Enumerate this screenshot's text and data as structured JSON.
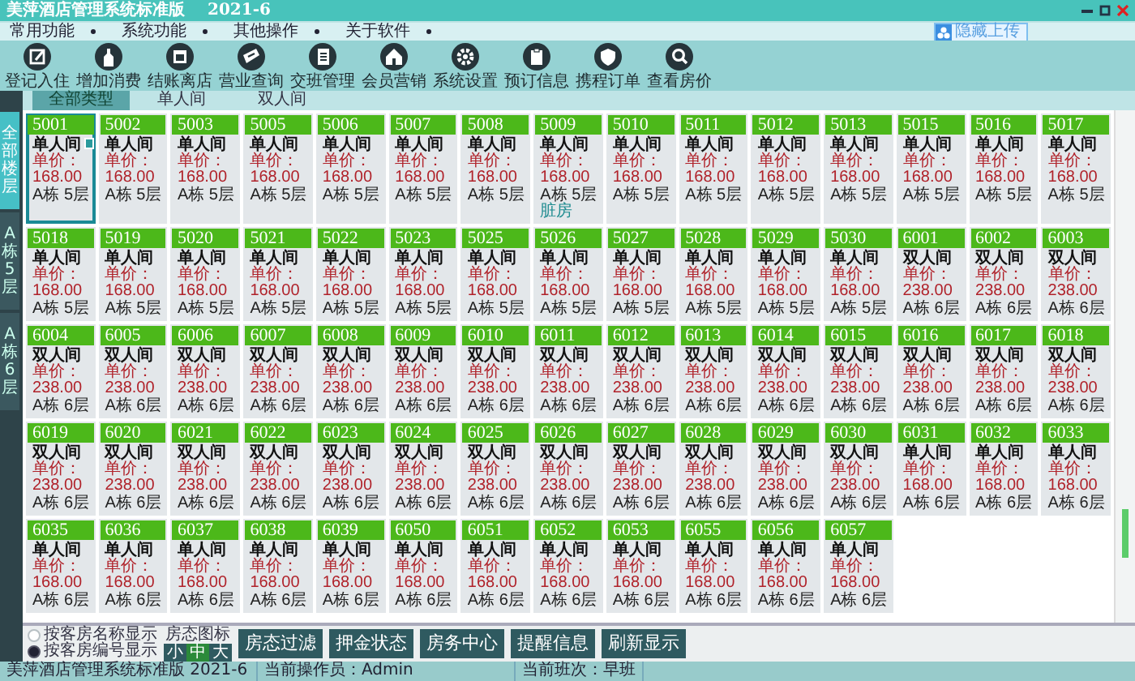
{
  "window": {
    "title": "美萍酒店管理系统标准版",
    "version": "2021-6"
  },
  "menu": [
    "常用功能",
    "系统功能",
    "其他操作",
    "关于软件"
  ],
  "upload_button": "隐藏上传",
  "toolbar": [
    "登记入住",
    "增加消费",
    "结账离店",
    "营业查询",
    "交班管理",
    "会员营销",
    "系统设置",
    "预订信息",
    "携程订单",
    "查看房价"
  ],
  "type_tabs": [
    {
      "label": "全部类型",
      "selected": true
    },
    {
      "label": "单人间",
      "selected": false
    },
    {
      "label": "双人间",
      "selected": false
    }
  ],
  "floor_tabs": [
    {
      "label": "全部楼层",
      "selected": true
    },
    {
      "label": "A栋5层",
      "selected": false
    },
    {
      "label": "A栋6层",
      "selected": false
    }
  ],
  "rooms": [
    {
      "number": "5001",
      "type": "单人间",
      "price": "单价：168.00",
      "location": "A栋 5层",
      "selected": true
    },
    {
      "number": "5002",
      "type": "单人间",
      "price": "单价：168.00",
      "location": "A栋 5层",
      "selected": false
    },
    {
      "number": "5003",
      "type": "单人间",
      "price": "单价：168.00",
      "location": "A栋 5层",
      "selected": false
    },
    {
      "number": "5005",
      "type": "单人间",
      "price": "单价：168.00",
      "location": "A栋 5层",
      "selected": false
    },
    {
      "number": "5006",
      "type": "单人间",
      "price": "单价：168.00",
      "location": "A栋 5层",
      "selected": false
    },
    {
      "number": "5007",
      "type": "单人间",
      "price": "单价：168.00",
      "location": "A栋 5层",
      "selected": false
    },
    {
      "number": "5008",
      "type": "单人间",
      "price": "单价：168.00",
      "location": "A栋 5层",
      "selected": false
    },
    {
      "number": "5009",
      "type": "单人间",
      "price": "单价：168.00",
      "location": "A栋 5层",
      "status": "脏房",
      "selected": false
    },
    {
      "number": "5010",
      "type": "单人间",
      "price": "单价：168.00",
      "location": "A栋 5层",
      "selected": false
    },
    {
      "number": "5011",
      "type": "单人间",
      "price": "单价：168.00",
      "location": "A栋 5层",
      "selected": false
    },
    {
      "number": "5012",
      "type": "单人间",
      "price": "单价：168.00",
      "location": "A栋 5层",
      "selected": false
    },
    {
      "number": "5013",
      "type": "单人间",
      "price": "单价：168.00",
      "location": "A栋 5层",
      "selected": false
    },
    {
      "number": "5015",
      "type": "单人间",
      "price": "单价：168.00",
      "location": "A栋 5层",
      "selected": false
    },
    {
      "number": "5016",
      "type": "单人间",
      "price": "单价：168.00",
      "location": "A栋 5层",
      "selected": false
    },
    {
      "number": "5017",
      "type": "单人间",
      "price": "单价：168.00",
      "location": "A栋 5层",
      "selected": false
    },
    {
      "number": "5018",
      "type": "单人间",
      "price": "单价：168.00",
      "location": "A栋 5层",
      "selected": false
    },
    {
      "number": "5019",
      "type": "单人间",
      "price": "单价：168.00",
      "location": "A栋 5层",
      "selected": false
    },
    {
      "number": "5020",
      "type": "单人间",
      "price": "单价：168.00",
      "location": "A栋 5层",
      "selected": false
    },
    {
      "number": "5021",
      "type": "单人间",
      "price": "单价：168.00",
      "location": "A栋 5层",
      "selected": false
    },
    {
      "number": "5022",
      "type": "单人间",
      "price": "单价：168.00",
      "location": "A栋 5层",
      "selected": false
    },
    {
      "number": "5023",
      "type": "单人间",
      "price": "单价：168.00",
      "location": "A栋 5层",
      "selected": false
    },
    {
      "number": "5025",
      "type": "单人间",
      "price": "单价：168.00",
      "location": "A栋 5层",
      "selected": false
    },
    {
      "number": "5026",
      "type": "单人间",
      "price": "单价：168.00",
      "location": "A栋 5层",
      "selected": false
    },
    {
      "number": "5027",
      "type": "单人间",
      "price": "单价：168.00",
      "location": "A栋 5层",
      "selected": false
    },
    {
      "number": "5028",
      "type": "单人间",
      "price": "单价：168.00",
      "location": "A栋 5层",
      "selected": false
    },
    {
      "number": "5029",
      "type": "单人间",
      "price": "单价：168.00",
      "location": "A栋 5层",
      "selected": false
    },
    {
      "number": "5030",
      "type": "单人间",
      "price": "单价：168.00",
      "location": "A栋 5层",
      "selected": false
    },
    {
      "number": "6001",
      "type": "双人间",
      "price": "单价：238.00",
      "location": "A栋 6层",
      "selected": false
    },
    {
      "number": "6002",
      "type": "双人间",
      "price": "单价：238.00",
      "location": "A栋 6层",
      "selected": false
    },
    {
      "number": "6003",
      "type": "双人间",
      "price": "单价：238.00",
      "location": "A栋 6层",
      "selected": false
    },
    {
      "number": "6004",
      "type": "双人间",
      "price": "单价：238.00",
      "location": "A栋 6层",
      "selected": false
    },
    {
      "number": "6005",
      "type": "双人间",
      "price": "单价：238.00",
      "location": "A栋 6层",
      "selected": false
    },
    {
      "number": "6006",
      "type": "双人间",
      "price": "单价：238.00",
      "location": "A栋 6层",
      "selected": false
    },
    {
      "number": "6007",
      "type": "双人间",
      "price": "单价：238.00",
      "location": "A栋 6层",
      "selected": false
    },
    {
      "number": "6008",
      "type": "双人间",
      "price": "单价：238.00",
      "location": "A栋 6层",
      "selected": false
    },
    {
      "number": "6009",
      "type": "双人间",
      "price": "单价：238.00",
      "location": "A栋 6层",
      "selected": false
    },
    {
      "number": "6010",
      "type": "双人间",
      "price": "单价：238.00",
      "location": "A栋 6层",
      "selected": false
    },
    {
      "number": "6011",
      "type": "双人间",
      "price": "单价：238.00",
      "location": "A栋 6层",
      "selected": false
    },
    {
      "number": "6012",
      "type": "双人间",
      "price": "单价：238.00",
      "location": "A栋 6层",
      "selected": false
    },
    {
      "number": "6013",
      "type": "双人间",
      "price": "单价：238.00",
      "location": "A栋 6层",
      "selected": false
    },
    {
      "number": "6014",
      "type": "双人间",
      "price": "单价：238.00",
      "location": "A栋 6层",
      "selected": false
    },
    {
      "number": "6015",
      "type": "双人间",
      "price": "单价：238.00",
      "location": "A栋 6层",
      "selected": false
    },
    {
      "number": "6016",
      "type": "双人间",
      "price": "单价：238.00",
      "location": "A栋 6层",
      "selected": false
    },
    {
      "number": "6017",
      "type": "双人间",
      "price": "单价：238.00",
      "location": "A栋 6层",
      "selected": false
    },
    {
      "number": "6018",
      "type": "双人间",
      "price": "单价：238.00",
      "location": "A栋 6层",
      "selected": false
    },
    {
      "number": "6019",
      "type": "双人间",
      "price": "单价：238.00",
      "location": "A栋 6层",
      "selected": false
    },
    {
      "number": "6020",
      "type": "双人间",
      "price": "单价：238.00",
      "location": "A栋 6层",
      "selected": false
    },
    {
      "number": "6021",
      "type": "双人间",
      "price": "单价：238.00",
      "location": "A栋 6层",
      "selected": false
    },
    {
      "number": "6022",
      "type": "双人间",
      "price": "单价：238.00",
      "location": "A栋 6层",
      "selected": false
    },
    {
      "number": "6023",
      "type": "双人间",
      "price": "单价：238.00",
      "location": "A栋 6层",
      "selected": false
    },
    {
      "number": "6024",
      "type": "双人间",
      "price": "单价：238.00",
      "location": "A栋 6层",
      "selected": false
    },
    {
      "number": "6025",
      "type": "双人间",
      "price": "单价：238.00",
      "location": "A栋 6层",
      "selected": false
    },
    {
      "number": "6026",
      "type": "双人间",
      "price": "单价：238.00",
      "location": "A栋 6层",
      "selected": false
    },
    {
      "number": "6027",
      "type": "双人间",
      "price": "单价：238.00",
      "location": "A栋 6层",
      "selected": false
    },
    {
      "number": "6028",
      "type": "双人间",
      "price": "单价：238.00",
      "location": "A栋 6层",
      "selected": false
    },
    {
      "number": "6029",
      "type": "双人间",
      "price": "单价：238.00",
      "location": "A栋 6层",
      "selected": false
    },
    {
      "number": "6030",
      "type": "双人间",
      "price": "单价：238.00",
      "location": "A栋 6层",
      "selected": false
    },
    {
      "number": "6031",
      "type": "单人间",
      "price": "单价：168.00",
      "location": "A栋 6层",
      "selected": false
    },
    {
      "number": "6032",
      "type": "单人间",
      "price": "单价：168.00",
      "location": "A栋 6层",
      "selected": false
    },
    {
      "number": "6033",
      "type": "单人间",
      "price": "单价：168.00",
      "location": "A栋 6层",
      "selected": false
    },
    {
      "number": "6035",
      "type": "单人间",
      "price": "单价：168.00",
      "location": "A栋 6层",
      "selected": false
    },
    {
      "number": "6036",
      "type": "单人间",
      "price": "单价：168.00",
      "location": "A栋 6层",
      "selected": false
    },
    {
      "number": "6037",
      "type": "单人间",
      "price": "单价：168.00",
      "location": "A栋 6层",
      "selected": false
    },
    {
      "number": "6038",
      "type": "单人间",
      "price": "单价：168.00",
      "location": "A栋 6层",
      "selected": false
    },
    {
      "number": "6039",
      "type": "单人间",
      "price": "单价：168.00",
      "location": "A栋 6层",
      "selected": false
    },
    {
      "number": "6050",
      "type": "单人间",
      "price": "单价：168.00",
      "location": "A栋 6层",
      "selected": false
    },
    {
      "number": "6051",
      "type": "单人间",
      "price": "单价：168.00",
      "location": "A栋 6层",
      "selected": false
    },
    {
      "number": "6052",
      "type": "单人间",
      "price": "单价：168.00",
      "location": "A栋 6层",
      "selected": false
    },
    {
      "number": "6053",
      "type": "单人间",
      "price": "单价：168.00",
      "location": "A栋 6层",
      "selected": false
    },
    {
      "number": "6055",
      "type": "单人间",
      "price": "单价：168.00",
      "location": "A栋 6层",
      "selected": false
    },
    {
      "number": "6056",
      "type": "单人间",
      "price": "单价：168.00",
      "location": "A栋 6层",
      "selected": false
    },
    {
      "number": "6057",
      "type": "单人间",
      "price": "单价：168.00",
      "location": "A栋 6层",
      "selected": false
    }
  ],
  "display_options": [
    {
      "label": "按客房名称显示",
      "selected": false
    },
    {
      "label": "按客房编号显示",
      "selected": true
    }
  ],
  "icon_size": {
    "label": "房态图标",
    "options": [
      {
        "label": "小",
        "selected": false
      },
      {
        "label": "中",
        "selected": true
      },
      {
        "label": "大",
        "selected": false
      }
    ]
  },
  "action_buttons": [
    "房态过滤",
    "押金状态",
    "房务中心",
    "提醒信息",
    "刷新显示"
  ],
  "status_bar": [
    "美萍酒店管理系统标准版 2021-6",
    "当前操作员：Admin",
    "当前班次：早班"
  ]
}
